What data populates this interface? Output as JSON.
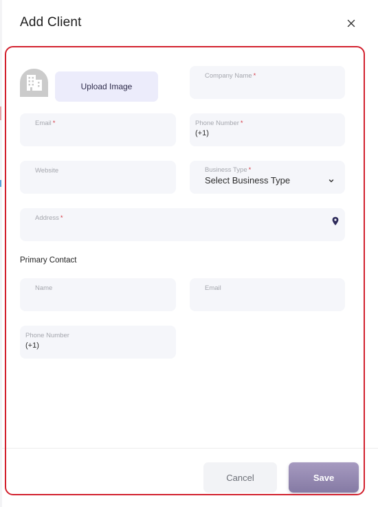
{
  "dialog": {
    "title": "Add Client",
    "close_icon": "close-icon"
  },
  "company": {
    "avatar_icon": "building-icon",
    "upload_label": "Upload Image",
    "company_name": {
      "label": "Company Name",
      "required": "*",
      "value": ""
    },
    "email": {
      "label": "Email",
      "required": "*",
      "value": ""
    },
    "phone": {
      "label": "Phone Number",
      "required": "*",
      "value": "(+1)"
    },
    "website": {
      "label": "Website",
      "value": ""
    },
    "business_type": {
      "label": "Business Type",
      "required": "*",
      "value": "Select Business Type",
      "icon": "chevron-down-icon"
    },
    "address": {
      "label": "Address",
      "required": "*",
      "value": "",
      "icon": "map-pin-icon"
    }
  },
  "primary_contact": {
    "heading": "Primary Contact",
    "name": {
      "label": "Name",
      "value": ""
    },
    "email": {
      "label": "Email",
      "value": ""
    },
    "phone": {
      "label": "Phone Number",
      "value": "(+1)"
    }
  },
  "footer": {
    "cancel_label": "Cancel",
    "save_label": "Save"
  },
  "colors": {
    "outline": "#d21f2c",
    "save_button": "#958ab3",
    "upload_button": "#ececfb",
    "field_bg": "#f5f6fa",
    "pin_icon": "#2d2a5a"
  }
}
